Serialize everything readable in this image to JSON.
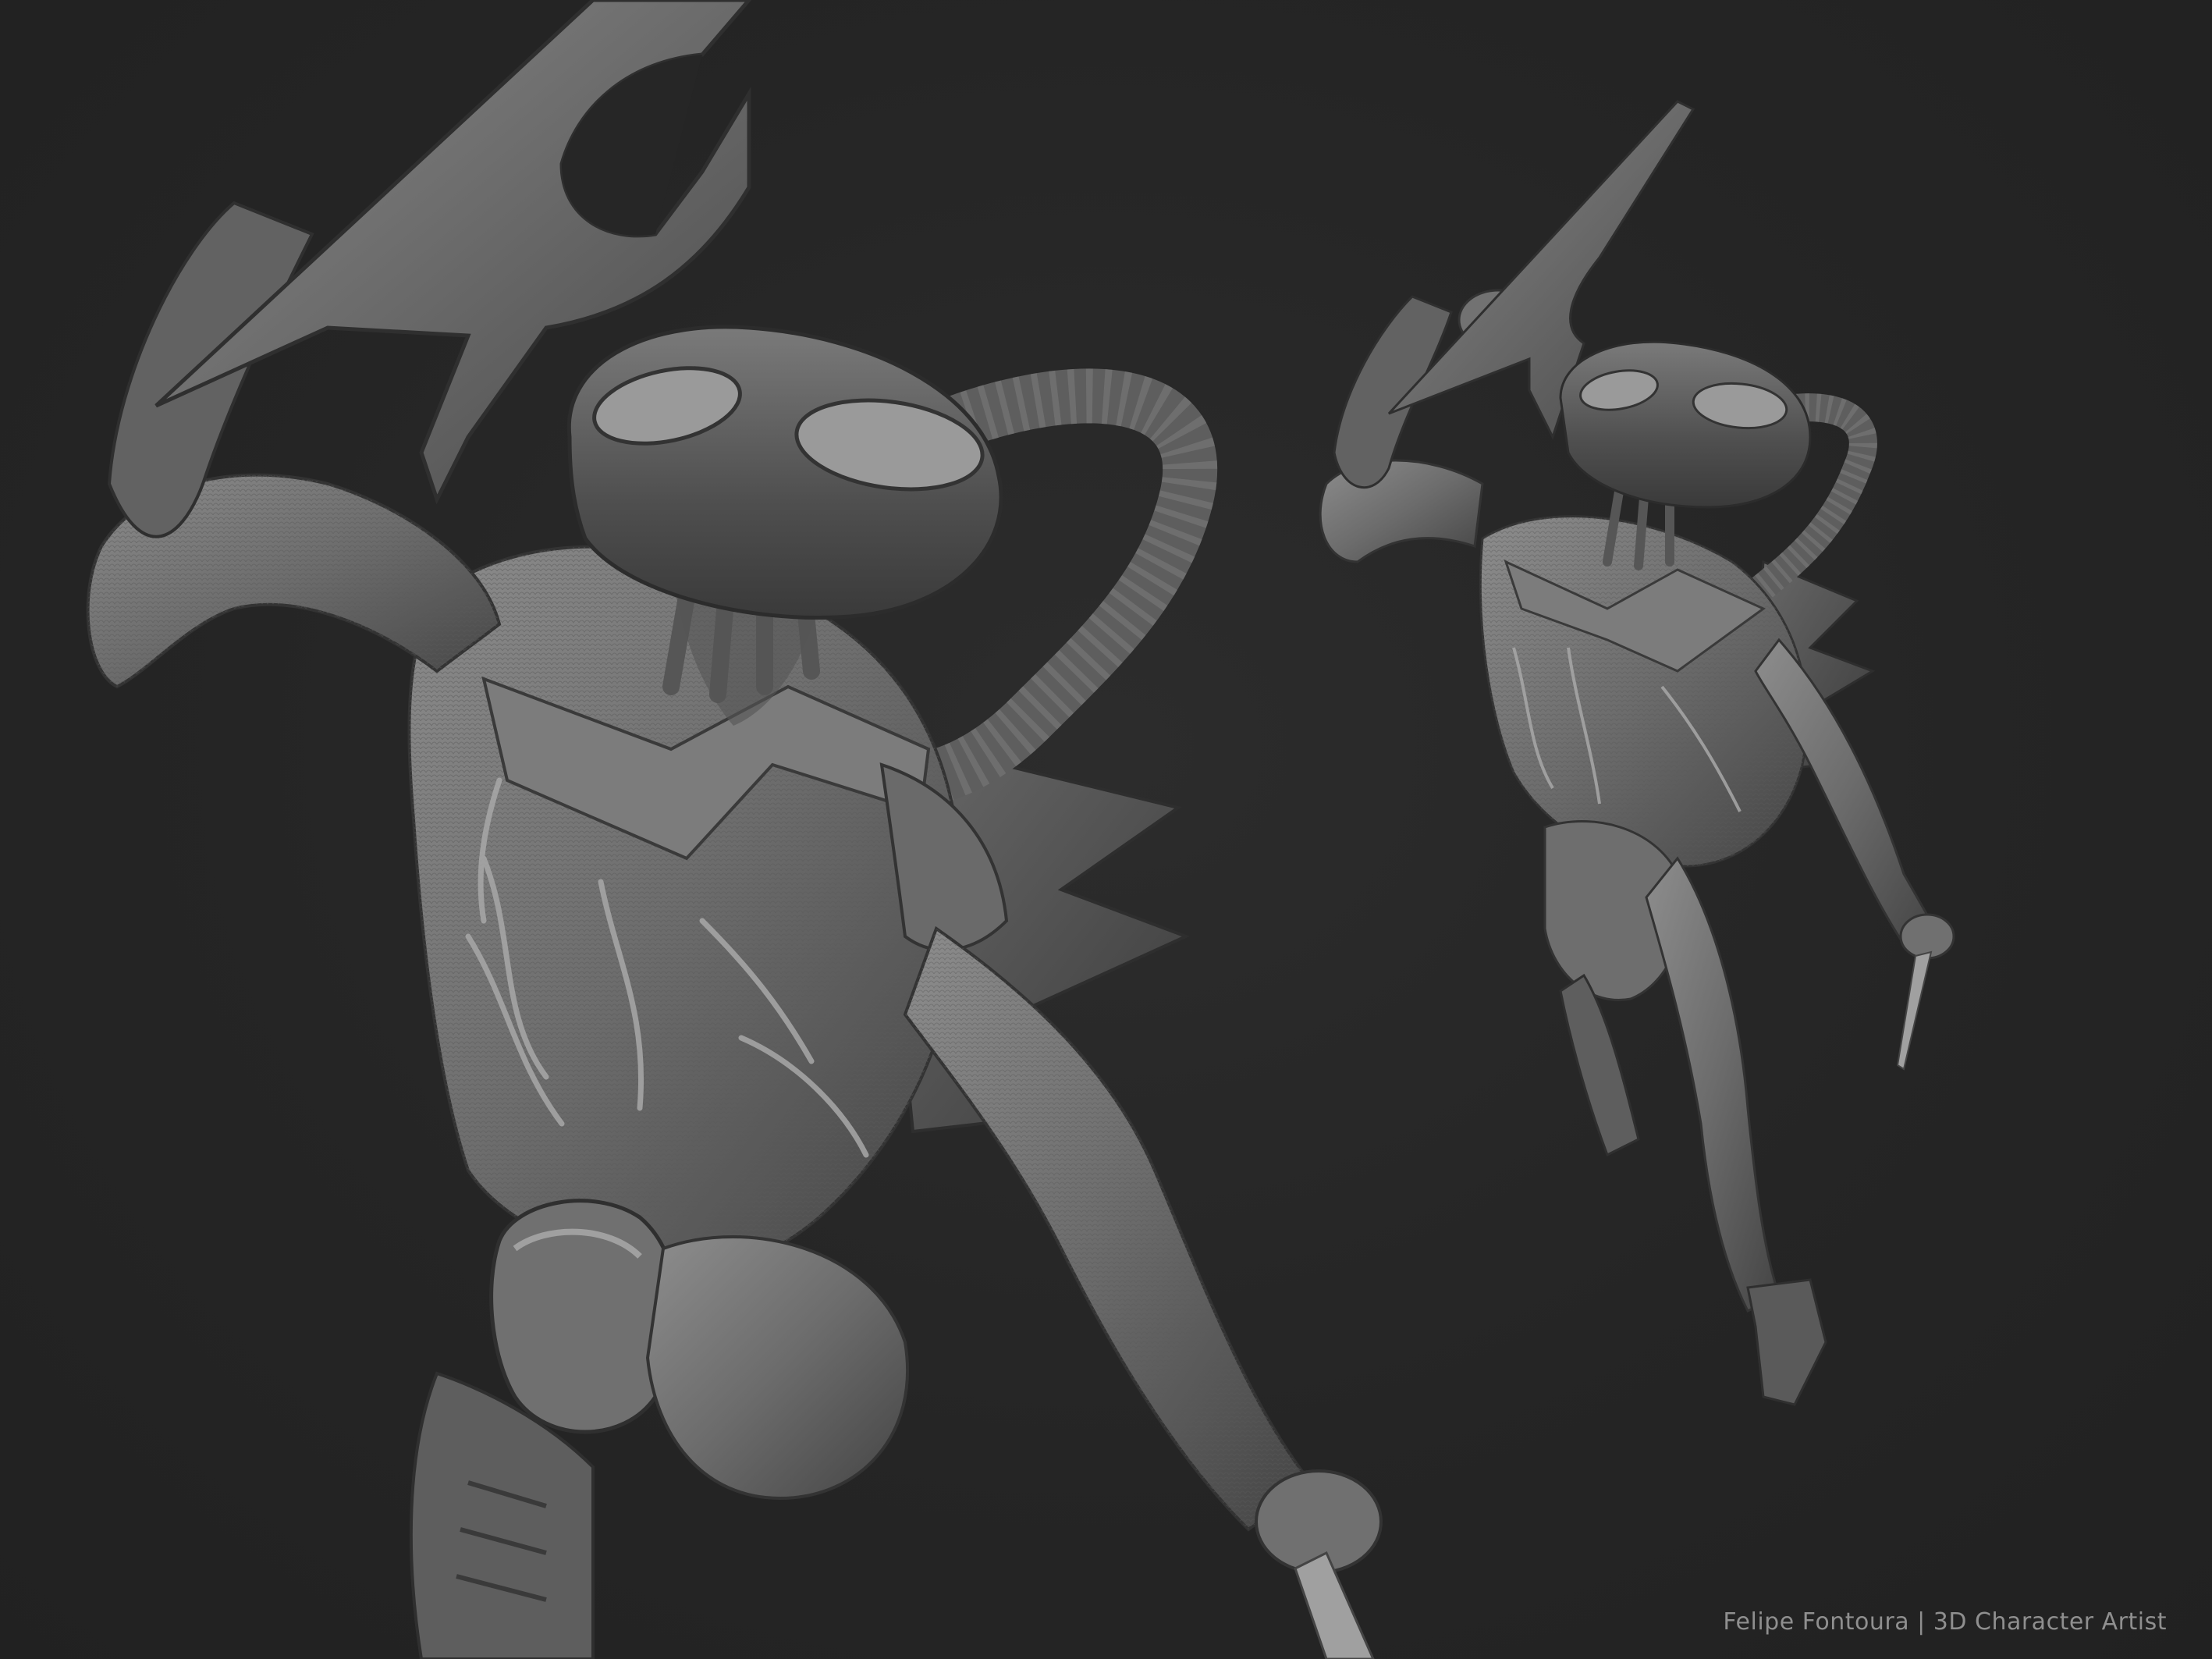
{
  "image": {
    "description_colors": {
      "background": "#262626",
      "model_light": "#9a9a9a",
      "model_mid": "#6e6e6e",
      "model_dark": "#3d3d3d"
    }
  },
  "credit": {
    "text": "Felipe Fontoura | 3D Character Artist"
  }
}
